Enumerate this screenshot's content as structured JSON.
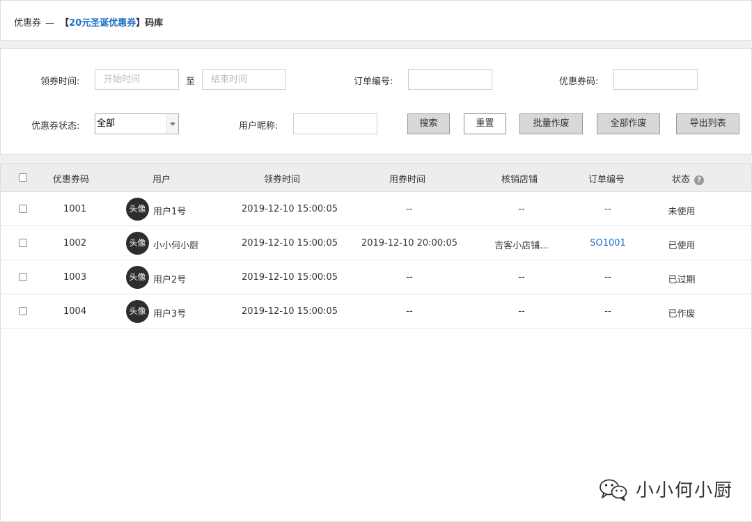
{
  "header": {
    "prefix": "优惠券",
    "separator": "—",
    "bracket_open": "【",
    "coupon_name": "20元圣诞优惠券",
    "bracket_close": "】",
    "suffix": "码库"
  },
  "filters": {
    "receive_time_label": "领券时间:",
    "start_placeholder": "开始时间",
    "to_label": "至",
    "end_placeholder": "结束时间",
    "order_no_label": "订单编号:",
    "order_no_value": "",
    "coupon_code_label": "优惠券码:",
    "coupon_code_value": "",
    "status_label": "优惠券状态:",
    "status_selected": "全部",
    "nickname_label": "用户昵称:",
    "nickname_value": ""
  },
  "buttons": {
    "search": "搜索",
    "reset": "重置",
    "batch_void": "批量作废",
    "void_all": "全部作废",
    "export": "导出列表"
  },
  "table": {
    "columns": {
      "code": "优惠券码",
      "user": "用户",
      "receive_time": "领券时间",
      "use_time": "用券时间",
      "store": "核销店铺",
      "order_no": "订单编号",
      "status": "状态"
    },
    "help_icon_glyph": "?",
    "rows": [
      {
        "code": "1001",
        "avatar": "头像",
        "user": "用户1号",
        "receive_time": "2019-12-10 15:00:05",
        "use_time": "--",
        "store": "--",
        "order_no": "--",
        "status": "未使用"
      },
      {
        "code": "1002",
        "avatar": "头像",
        "user": "小小何小厨",
        "receive_time": "2019-12-10 15:00:05",
        "use_time": "2019-12-10 20:00:05",
        "store": "吉客小店铺...",
        "order_no": "SO1001",
        "status": "已使用"
      },
      {
        "code": "1003",
        "avatar": "头像",
        "user": "用户2号",
        "receive_time": "2019-12-10 15:00:05",
        "use_time": "--",
        "store": "--",
        "order_no": "--",
        "status": "已过期"
      },
      {
        "code": "1004",
        "avatar": "头像",
        "user": "用户3号",
        "receive_time": "2019-12-10 15:00:05",
        "use_time": "--",
        "store": "--",
        "order_no": "--",
        "status": "已作废"
      }
    ]
  },
  "watermark": {
    "text": "小小何小厨",
    "icon": "wechat-icon"
  },
  "colors": {
    "link": "#1a6fc4",
    "button_gray": "#d8d8d8",
    "header_bg": "#ededed"
  }
}
